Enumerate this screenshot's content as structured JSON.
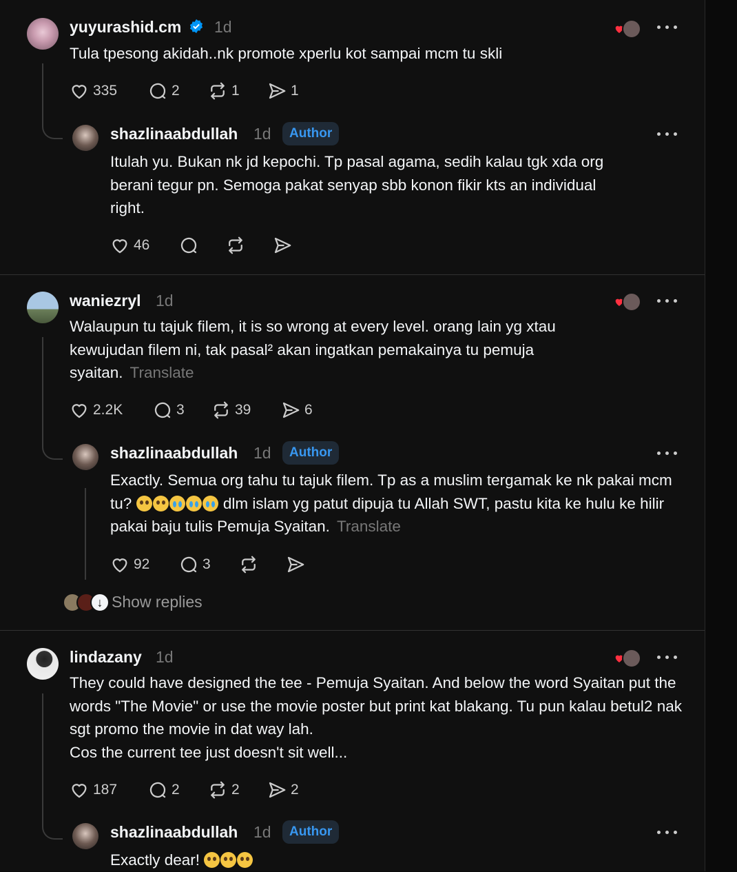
{
  "comments": [
    {
      "username": "yuyurashid.cm",
      "verified": true,
      "time": "1d",
      "text": "Tula tpesong akidah..nk promote xperlu kot sampai mcm tu skli",
      "stats": {
        "likes": "335",
        "replies": "2",
        "reposts": "1",
        "shares": "1"
      },
      "reply": {
        "username": "shazlinaabdullah",
        "time": "1d",
        "badge": "Author",
        "text": "Itulah yu. Bukan nk jd kepochi. Tp pasal agama, sedih kalau tgk xda org berani tegur pn. Semoga pakat senyap sbb konon fikir kts an individual right.",
        "stats": {
          "likes": "46"
        }
      }
    },
    {
      "username": "waniezryl",
      "time": "1d",
      "text": "Walaupun tu tajuk filem, it is so wrong at every level. orang lain yg xtau kewujudan filem ni, tak pasal² akan ingatkan pemakainya tu pemuja syaitan.",
      "translate": "Translate",
      "stats": {
        "likes": "2.2K",
        "replies": "3",
        "reposts": "39",
        "shares": "6"
      },
      "reply": {
        "username": "shazlinaabdullah",
        "time": "1d",
        "badge": "Author",
        "text_a": "Exactly. Semua org tahu tu tajuk filem. Tp as a muslim tergamak ke nk pakai mcm tu?",
        "text_b": "dlm islam yg patut dipuja tu Allah SWT, pastu kita ke hulu ke hilir pakai baju tulis Pemuja Syaitan.",
        "translate": "Translate",
        "stats": {
          "likes": "92",
          "replies": "3"
        }
      },
      "show_replies": "Show replies"
    },
    {
      "username": "lindazany",
      "time": "1d",
      "text_lines": [
        "They could have designed the tee - Pemuja Syaitan. And below the word Syaitan put the words \"The Movie\" or use the movie poster but print kat blakang. Tu pun kalau betul2 nak sgt promo the movie in dat way lah.",
        "Cos the current tee just doesn't sit well..."
      ],
      "stats": {
        "likes": "187",
        "replies": "2",
        "reposts": "2",
        "shares": "2"
      },
      "reply": {
        "username": "shazlinaabdullah",
        "time": "1d",
        "badge": "Author",
        "text": "Exactly dear!"
      }
    }
  ],
  "colors": {
    "background": "#101010",
    "badge_text": "#3897f0",
    "verified": "#0095f6",
    "heart": "#ff3040"
  },
  "icons": [
    "heart-icon",
    "comment-icon",
    "repost-icon",
    "share-icon",
    "more-icon",
    "verified-icon"
  ]
}
